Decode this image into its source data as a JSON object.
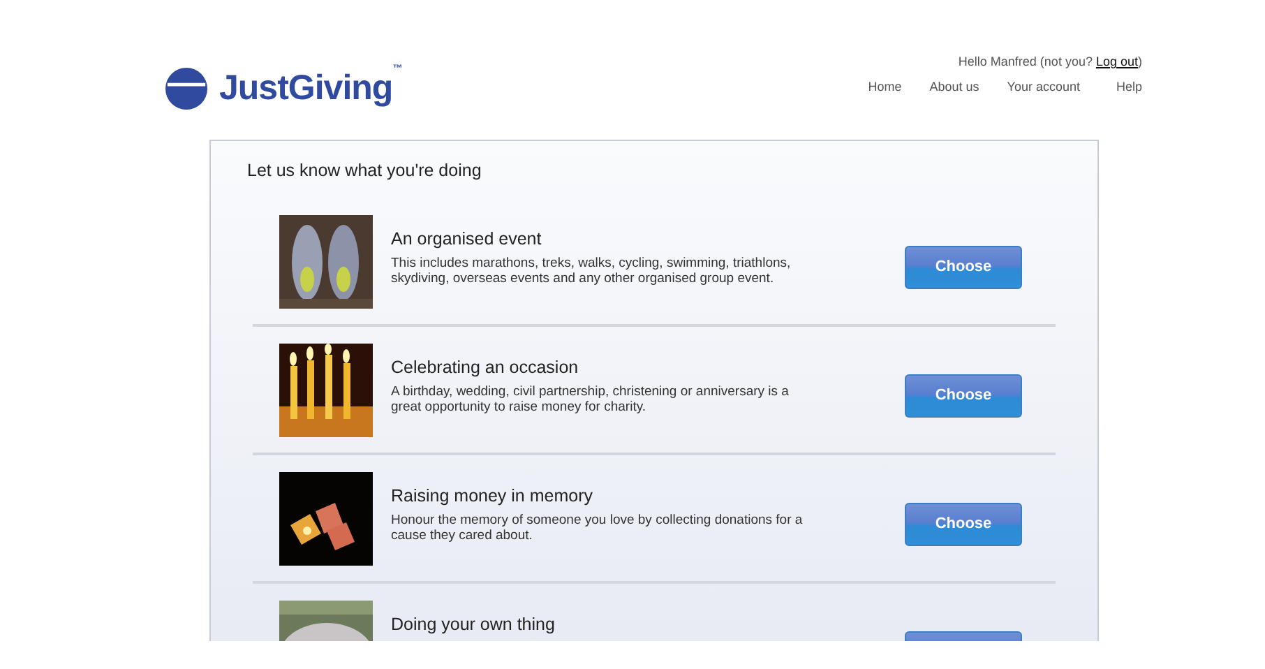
{
  "brand": {
    "name": "JustGiving",
    "mark": "™"
  },
  "account": {
    "greeting": "Hello Manfred (not you? ",
    "link": "Log out",
    "closing": ")"
  },
  "nav": [
    "Home",
    "About us",
    "Your account",
    "Help"
  ],
  "panel": {
    "heading": "Let us know what you're doing",
    "options": [
      {
        "kind": "picture",
        "title": "An organised event",
        "description": "This includes marathons, treks, walks, cycling, swimming, triathlons, skydiving, overseas events and any other organised group event.",
        "button": "Choose"
      },
      {
        "kind": "picture",
        "title": "Celebrating an occasion",
        "description": "A birthday, wedding, civil partnership, christening or anniversary is a great opportunity to raise money for charity.",
        "button": "Choose"
      },
      {
        "kind": "picture",
        "title": "Raising money in memory",
        "description": "Honour the memory of someone you love by collecting donations for a cause they cared about.",
        "button": "Choose"
      },
      {
        "kind": "picture",
        "title": "Doing your own thing"
      }
    ]
  }
}
